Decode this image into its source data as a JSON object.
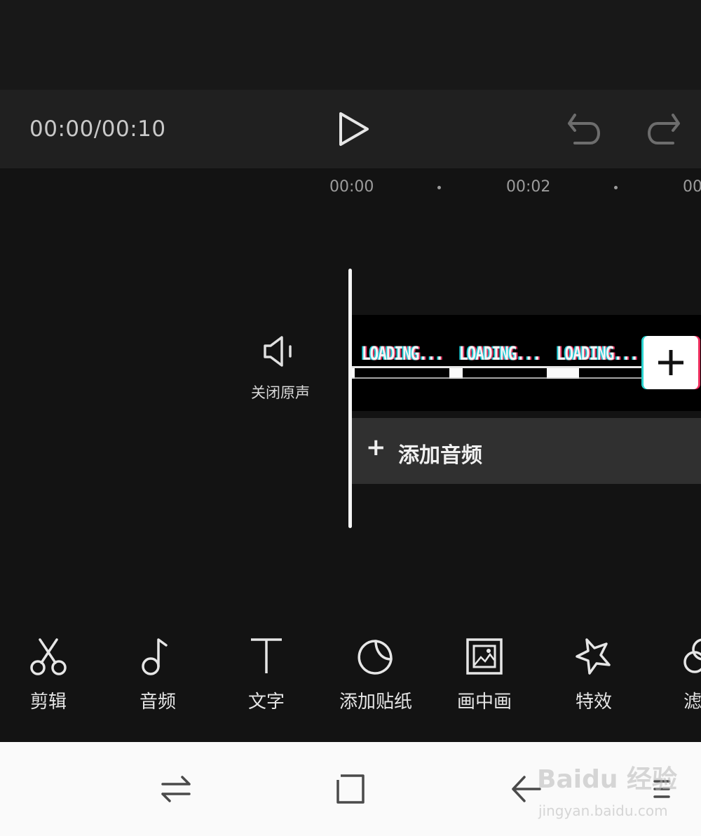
{
  "player": {
    "time": "00:00/00:10"
  },
  "ruler": {
    "labels": [
      "00:00",
      "00:02",
      "00"
    ]
  },
  "track_controls": {
    "mute_label": "关闭原声"
  },
  "video_track": {
    "frame_text": "LOADING...",
    "frame_progress": [
      0.03,
      0.14,
      0.33
    ]
  },
  "audio_track": {
    "plus": "+",
    "label": "添加音频"
  },
  "toolbar": {
    "items": [
      {
        "label": "剪辑",
        "icon": "scissors-icon"
      },
      {
        "label": "音频",
        "icon": "music-note-icon"
      },
      {
        "label": "文字",
        "icon": "text-icon"
      },
      {
        "label": "添加贴纸",
        "icon": "sticker-icon"
      },
      {
        "label": "画中画",
        "icon": "picture-in-picture-icon"
      },
      {
        "label": "特效",
        "icon": "effects-star-icon"
      },
      {
        "label": "滤",
        "icon": "filter-icon"
      }
    ]
  },
  "watermark": {
    "main": "Baidu 经验",
    "sub": "jingyan.baidu.com"
  },
  "colors": {
    "background": "#131313",
    "playbar": "#202020",
    "audio_track": "#303030",
    "accent_cyan": "#29d3cf",
    "accent_pink": "#ec2c5c"
  }
}
